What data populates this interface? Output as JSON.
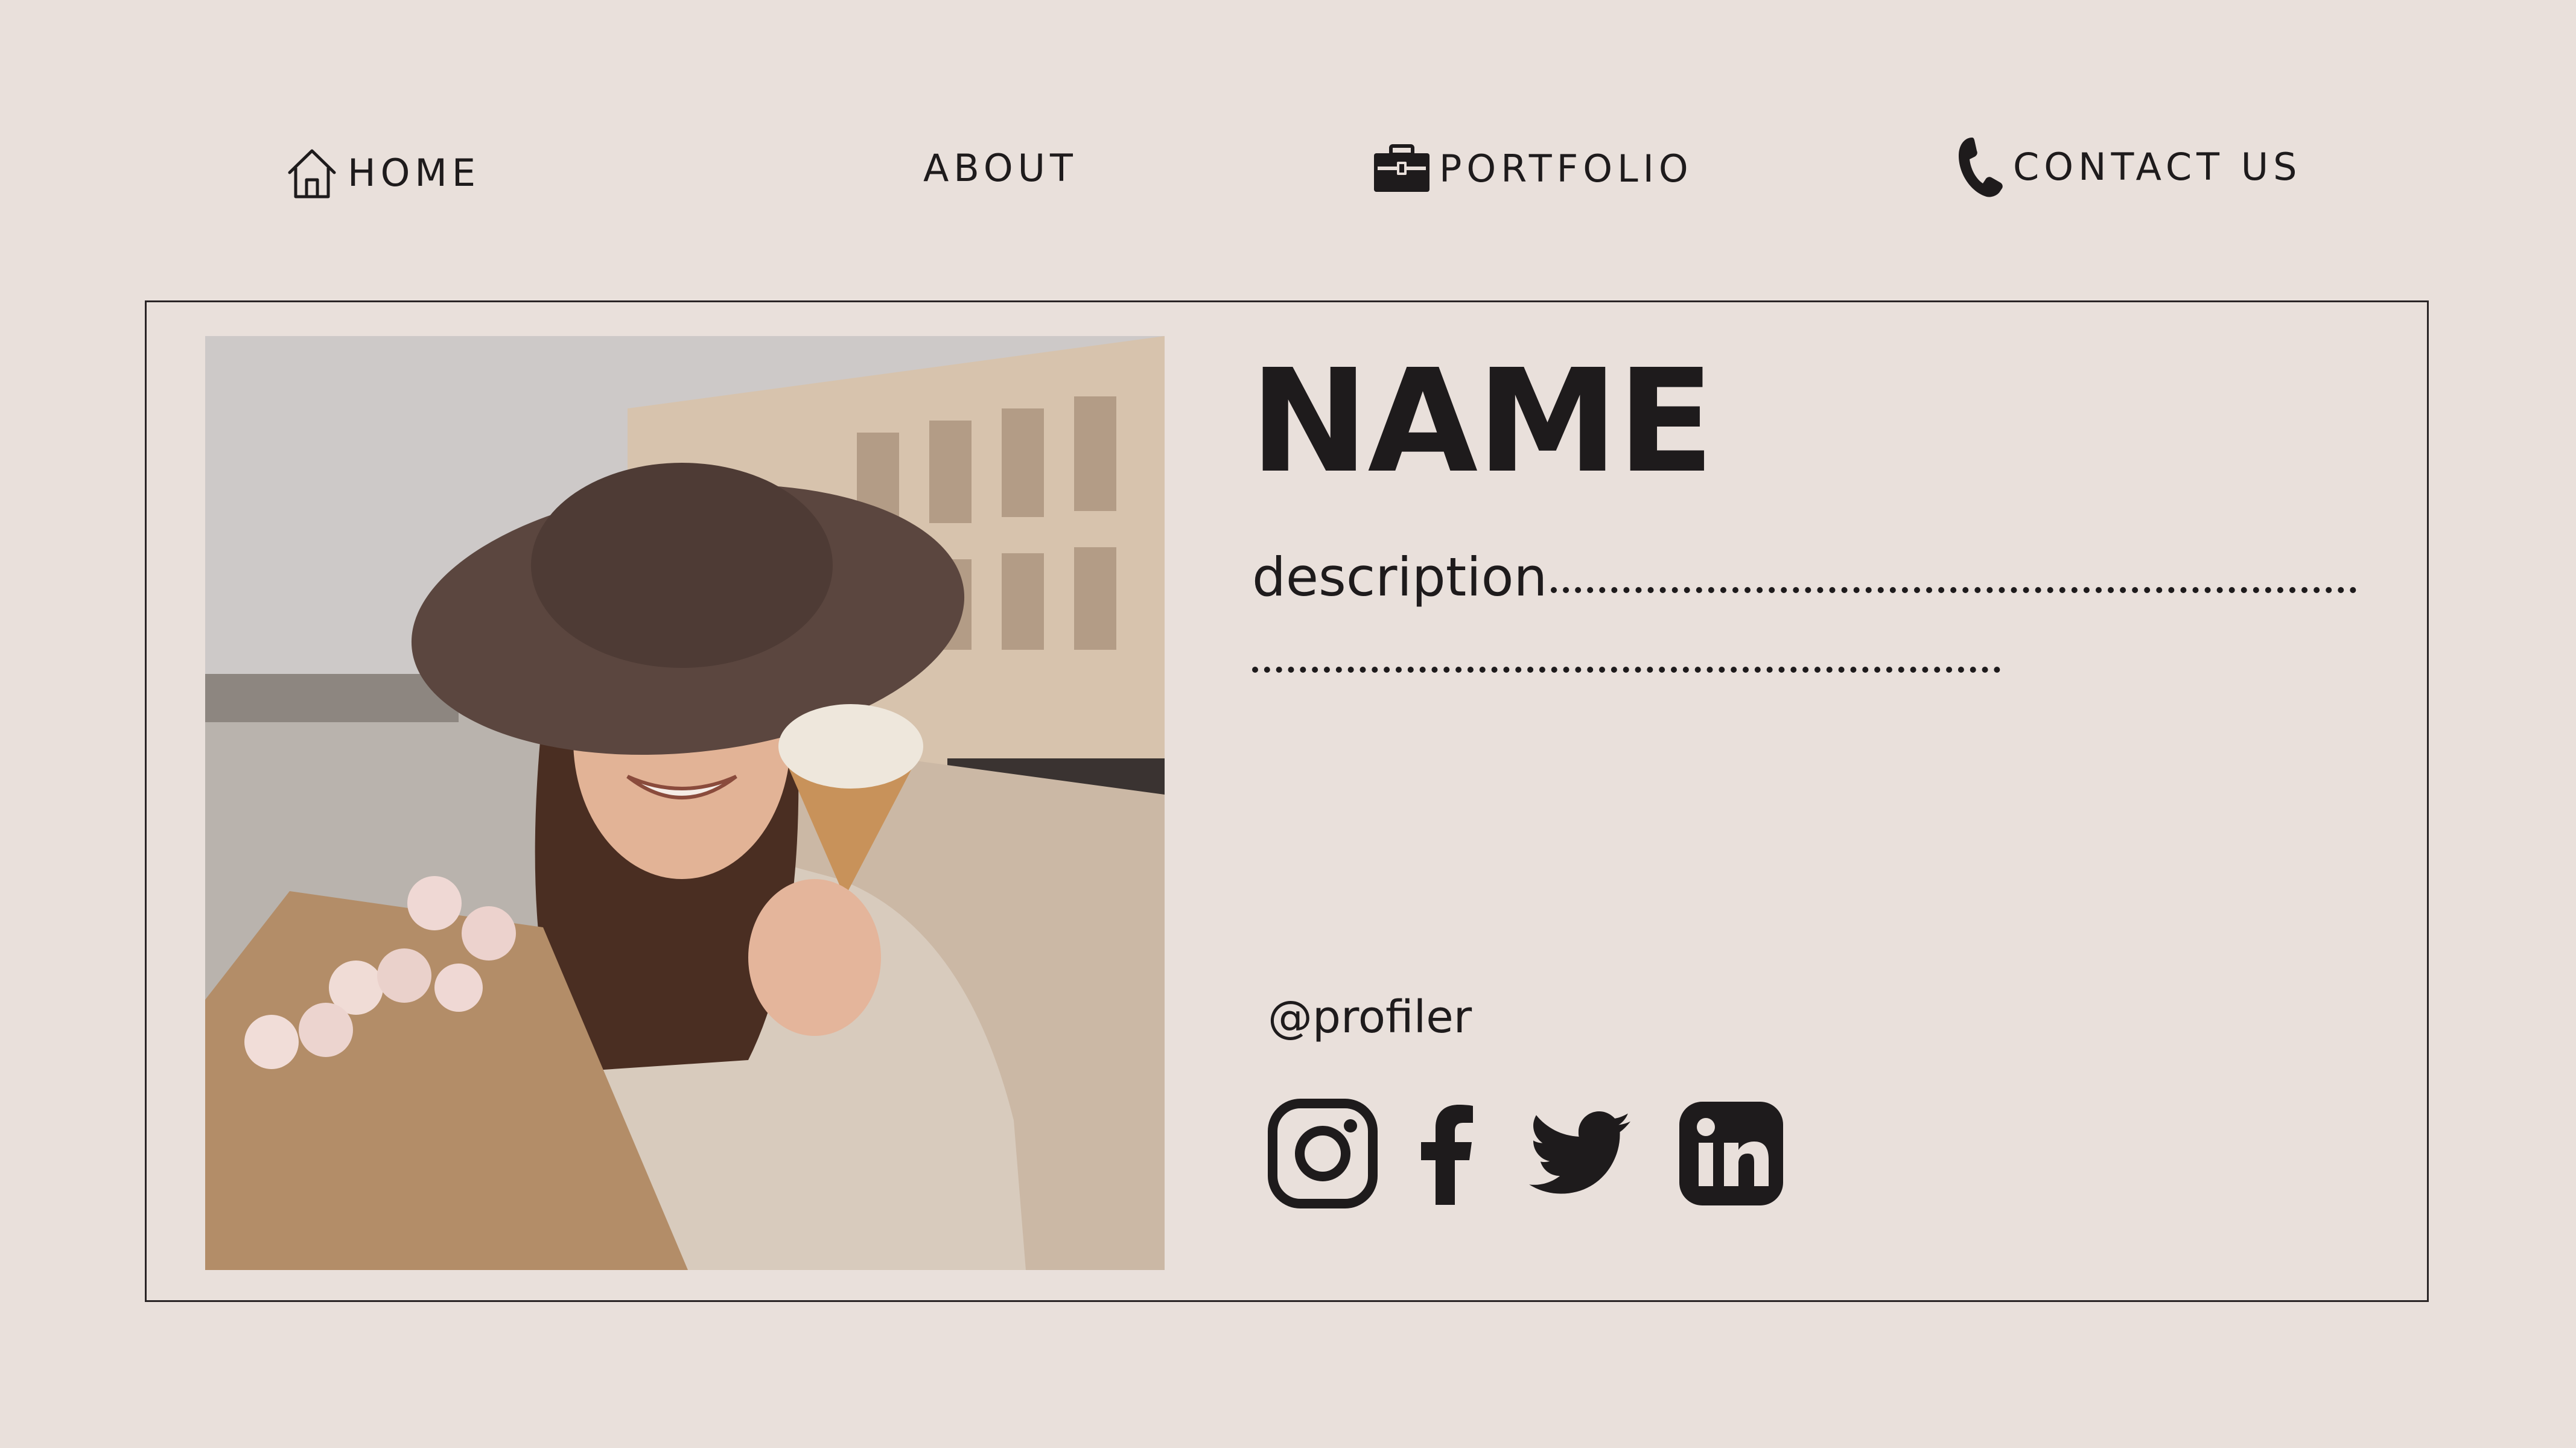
{
  "nav": {
    "items": [
      {
        "label": "HOME",
        "icon": "home-icon"
      },
      {
        "label": "ABOUT",
        "icon": ""
      },
      {
        "label": "PORTFOLIO",
        "icon": "briefcase-icon"
      },
      {
        "label": "CONTACT US",
        "icon": "phone-icon"
      }
    ]
  },
  "profile": {
    "name": "NAME",
    "description": "description",
    "handle": "@profiler",
    "photo_icon": "profile-photo"
  },
  "socials": [
    {
      "icon": "instagram-icon"
    },
    {
      "icon": "facebook-icon"
    },
    {
      "icon": "twitter-icon"
    },
    {
      "icon": "linkedin-icon"
    }
  ],
  "colors": {
    "background": "#e9e0db",
    "text": "#1e1b1c",
    "border": "#2a2526"
  }
}
